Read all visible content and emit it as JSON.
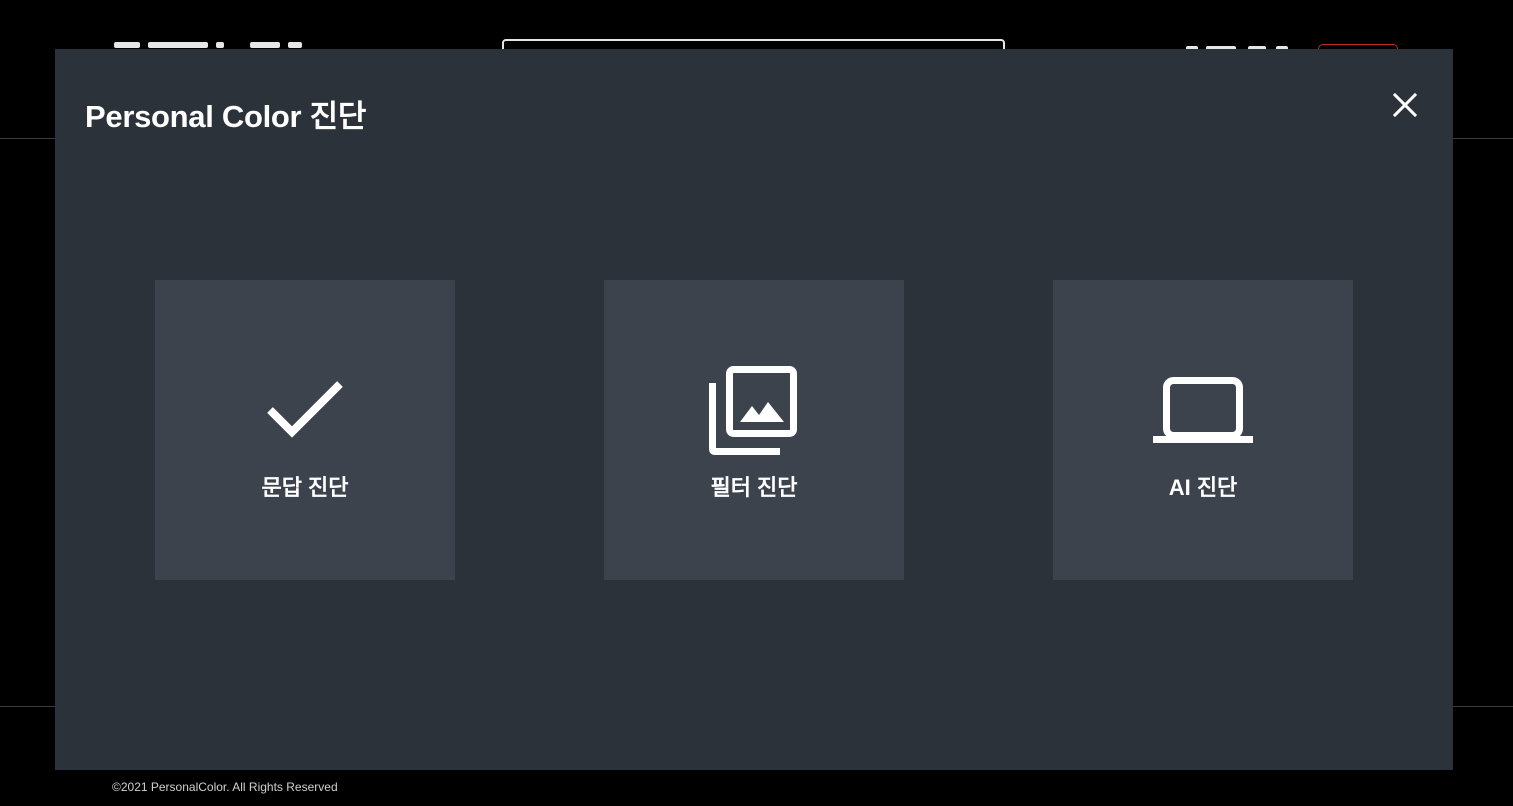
{
  "modal": {
    "title": "Personal Color 진단",
    "close_icon": "close-icon",
    "options": [
      {
        "label": "문답 진단",
        "icon": "checkmark-icon"
      },
      {
        "label": "필터 진단",
        "icon": "image-gallery-icon"
      },
      {
        "label": "AI 진단",
        "icon": "laptop-icon"
      }
    ]
  },
  "footer": {
    "copyright": "©2021 PersonalColor. All Rights Reserved"
  },
  "colors": {
    "backdrop": "#000000",
    "modal_bg": "#2c323a",
    "card_bg": "#3c434d",
    "text": "#ffffff"
  }
}
